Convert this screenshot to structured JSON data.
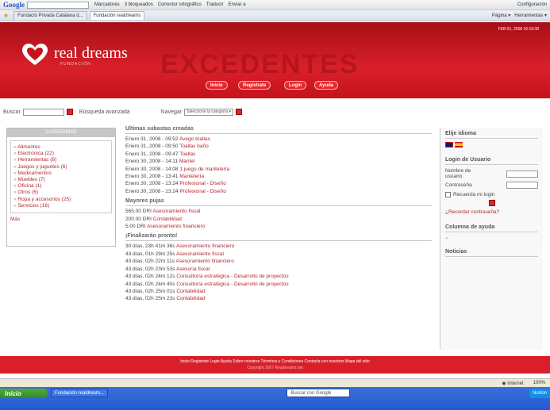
{
  "toolbar": {
    "google_logo": "Google",
    "items": [
      "Marcadores",
      "3 bloqueados",
      "Corrector ortográfico",
      "Traducir",
      "Enviar a"
    ],
    "config": "Configuración"
  },
  "tabs": {
    "items": [
      "Fundació Privada Catalana d...",
      "Fundación realdreams"
    ],
    "right_items": [
      "Página",
      "Herramientas"
    ]
  },
  "site": {
    "logo_text": "real dreams",
    "logo_sub": "FUNDACIÓN",
    "big_text": "EXCEDENTES",
    "date": "FEB 01, 2008 16:19:38",
    "nav": [
      "Inicio",
      "Registrate",
      "Login",
      "Ayuda"
    ]
  },
  "search": {
    "label": "Buscar",
    "advanced": "Búsqueda avanzada",
    "navegar": "Navegar",
    "category_select": "Seleccione la categoría"
  },
  "categories": {
    "header": "CATEGORIAS",
    "items": [
      "Alimentos",
      "Electrónica (22)",
      "Herramientas (8)",
      "Juegos y juguetes (6)",
      "Medicamentos",
      "Muebles (7)",
      "Oficina (1)",
      "Otros (6)",
      "Ropa y accesorios (25)",
      "Servicios (16)"
    ],
    "more": "Más"
  },
  "subastas": {
    "title": "Ultimas subastas creadas",
    "rows": [
      {
        "date": "Enero 31, 2008 - 09:52",
        "item": "Avego toallas"
      },
      {
        "date": "Enero 31, 2008 - 09:50",
        "item": "Toallas baño"
      },
      {
        "date": "Enero 31, 2008 - 09:47",
        "item": "Toallas"
      },
      {
        "date": "Enero 30, 2008 - 14:11",
        "item": "Mantel"
      },
      {
        "date": "Enero 30, 2008 - 14:08",
        "item": "1 juego de mantelería"
      },
      {
        "date": "Enero 30, 2008 - 13:41",
        "item": "Mantelería"
      },
      {
        "date": "Enero 30, 2008 - 13:24",
        "item": "Profesional - Diseño"
      },
      {
        "date": "Enero 30, 2008 - 13:24",
        "item": "Profesional - Diseño"
      }
    ]
  },
  "pujas": {
    "title": "Mayores pujas",
    "rows": [
      {
        "amount": "565.00 DRI",
        "item": "Asesoramiento fiscal"
      },
      {
        "amount": "200.00 DRI",
        "item": "Contabilidad"
      },
      {
        "amount": "5.00 DRI",
        "item": "Asesoramiento financiero"
      }
    ]
  },
  "finalizan": {
    "title": "¡Finalizarán pronto!",
    "rows": [
      {
        "time": "30 días, 23h 41m 36s",
        "item": "Asesoramiento financiero"
      },
      {
        "time": "43 días, 01h 29m 25s",
        "item": "Asesoramiento fiscal"
      },
      {
        "time": "43 días, 02h 22m 11s",
        "item": "Asesoramiento financiero"
      },
      {
        "time": "43 días, 02h 23m 53s",
        "item": "Asesoría fiscal"
      },
      {
        "time": "43 días, 02h 24m 12s",
        "item": "Consultoría estratégica - Desarrollo de proyectos"
      },
      {
        "time": "43 días, 02h 24m 40s",
        "item": "Consultoría estratégica - Desarrollo de proyectos"
      },
      {
        "time": "43 días, 02h 25m 01s",
        "item": "Contabilidad"
      },
      {
        "time": "43 días, 02h 25m 23s",
        "item": "Contabilidad"
      }
    ]
  },
  "sidebar": {
    "idioma": "Elije idioma",
    "login_title": "Login de Usuario",
    "user_label": "Nombre de usuario",
    "pass_label": "Contraseña",
    "remember": "Recuerda mi login",
    "forgot": "¿Recordar contraseña?",
    "ayuda": "Columna de ayuda",
    "noticias": "Noticias"
  },
  "footer": {
    "links": "Inicio  Registrate  Login  Ayuda  Sobre nosotros  Términos y Condiciones  Contacta con nosotros  Mapa del sitio",
    "copy": "Copyright 2007 Realdreams.net"
  },
  "status": {
    "zone": "Internet",
    "zoom": "100%"
  },
  "taskbar": {
    "start": "Inicio",
    "task": "Fundación realdream...",
    "search": "Buscar con Google",
    "norton": "Norton"
  },
  "colors": {
    "brand_red": "#d9202a",
    "link_red": "#b3262e"
  }
}
